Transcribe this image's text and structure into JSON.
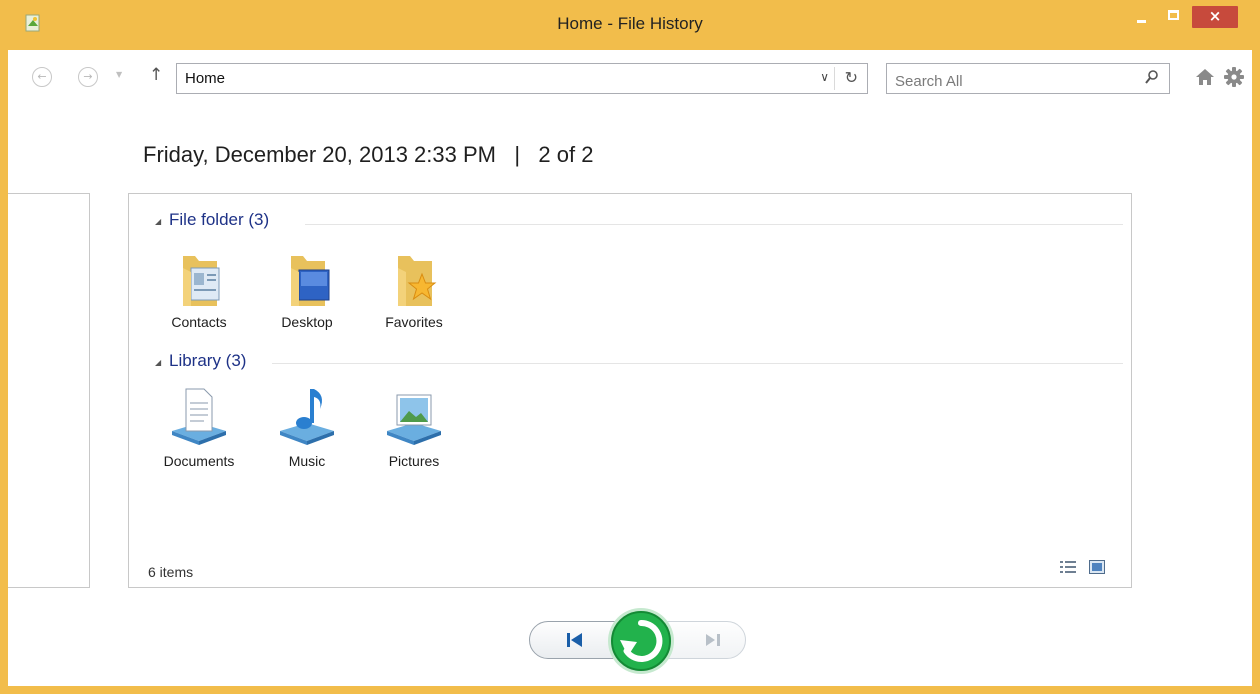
{
  "window": {
    "title": "Home - File History",
    "close_glyph": "×",
    "colors": {
      "frame": "#f2bd4b",
      "close": "#c74a3c",
      "group_label": "#1e3287",
      "restore": "#22b24c"
    }
  },
  "toolbar": {
    "back_icon": "back-arrow-icon",
    "forward_icon": "forward-arrow-icon",
    "up_icon": "up-arrow-icon",
    "address_value": "Home",
    "search_placeholder": "Search All",
    "glyphs": {
      "back": "←",
      "forward": "→",
      "dropdown": "▼",
      "up": "↑",
      "address_dropdown": "∨",
      "refresh": "↻"
    }
  },
  "header": {
    "datetime": "Friday, December 20, 2013 2:33 PM",
    "separator": "|",
    "position": "2 of 2"
  },
  "groups": [
    {
      "label": "File folder (3)",
      "collapse_glyph": "◢",
      "items": [
        {
          "label": "Contacts",
          "icon": "contacts-folder-icon"
        },
        {
          "label": "Desktop",
          "icon": "desktop-folder-icon"
        },
        {
          "label": "Favorites",
          "icon": "favorites-folder-icon"
        }
      ]
    },
    {
      "label": "Library (3)",
      "collapse_glyph": "◢",
      "items": [
        {
          "label": "Documents",
          "icon": "documents-library-icon"
        },
        {
          "label": "Music",
          "icon": "music-library-icon"
        },
        {
          "label": "Pictures",
          "icon": "pictures-library-icon"
        }
      ]
    }
  ],
  "status": {
    "items_count": "6 items"
  },
  "views": {
    "details_icon": "details-view-icon",
    "large_icons": "large-icons-view-icon"
  },
  "playback": {
    "previous_icon": "previous-version-icon",
    "restore_icon": "restore-icon",
    "next_icon": "next-version-icon"
  }
}
